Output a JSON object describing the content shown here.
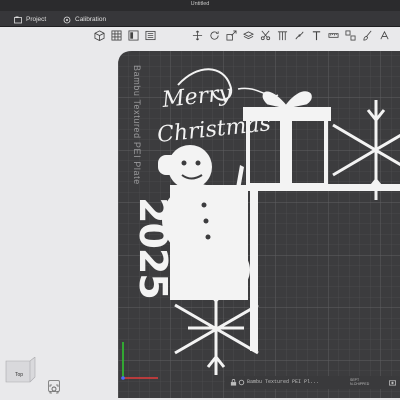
{
  "window": {
    "title": "Untitled"
  },
  "tabs": [
    {
      "label": "Project"
    },
    {
      "label": "Calibration"
    }
  ],
  "plate": {
    "label": "Bambu Textured PEI Plate",
    "design_text": [
      "Merry",
      "Christmas"
    ],
    "year_text": "2025",
    "bottom_text": "Bambu Textured PEI Pl...",
    "bottom_small": [
      "SEPT",
      "N-CHIPPED"
    ]
  },
  "view": {
    "label": "Top"
  },
  "colors": {
    "bed": "#3c3c3e",
    "grid": "#505053",
    "object": "#f3f3f3",
    "axis_x": "#e23b3b",
    "axis_y": "#2fc22f",
    "axis_z": "#4a6cff"
  },
  "icons": [
    "cube-icon",
    "grid-icon",
    "layout-icon",
    "plate-icon",
    "move-icon",
    "rotate-icon",
    "scale-icon",
    "cut-icon",
    "support-icon",
    "text-icon"
  ]
}
